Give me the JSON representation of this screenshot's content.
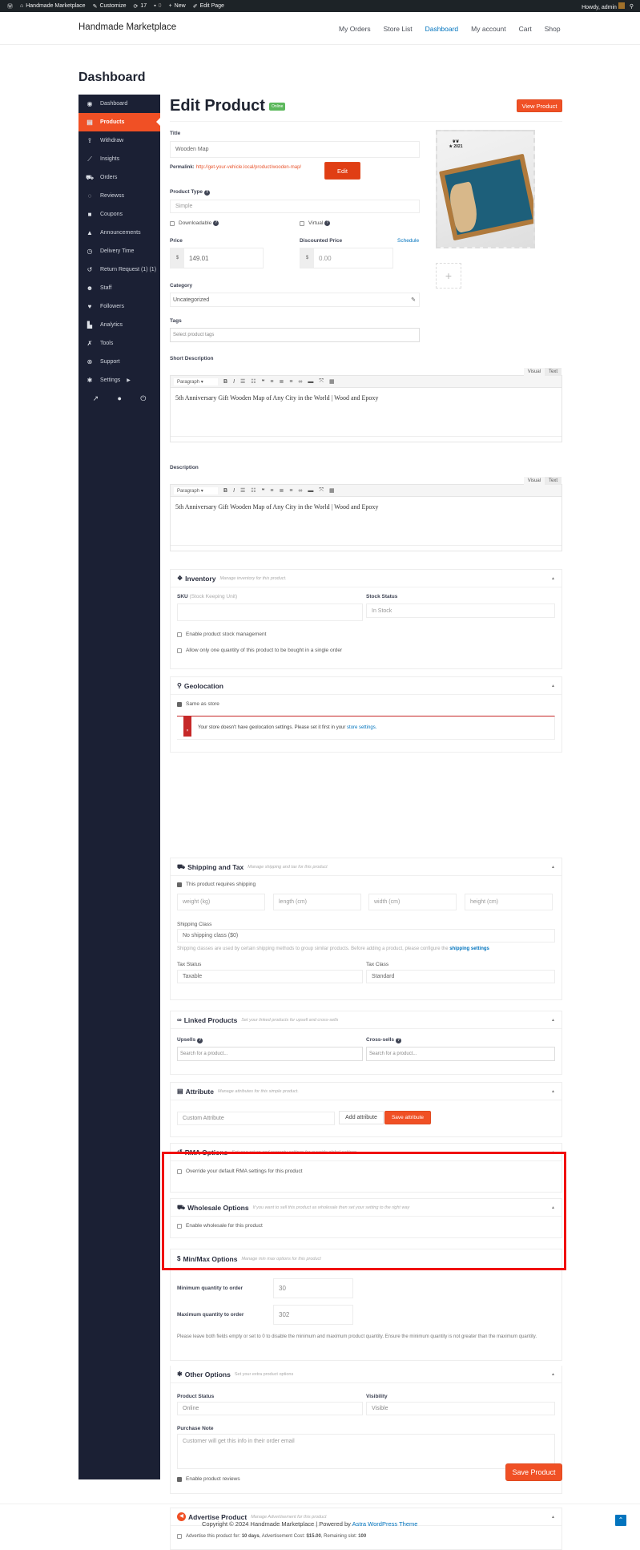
{
  "admin_bar": {
    "wp_icon": "wordpress-logo-icon",
    "site_name": "Handmade Marketplace",
    "customize": "Customize",
    "updates_count": "17",
    "comments_count": "0",
    "new_label": "New",
    "edit_page": "Edit Page",
    "howdy": "Howdy, admin"
  },
  "header": {
    "site_title": "Handmade Marketplace",
    "nav": [
      "My Orders",
      "Store List",
      "Dashboard",
      "My account",
      "Cart",
      "Shop"
    ],
    "active_nav": "Dashboard"
  },
  "page_heading": "Dashboard",
  "sidebar": {
    "items": [
      {
        "label": "Dashboard",
        "icon": "dashboard-icon"
      },
      {
        "label": "Products",
        "icon": "briefcase-icon",
        "active": true
      },
      {
        "label": "Withdraw",
        "icon": "upload-icon"
      },
      {
        "label": "Insights",
        "icon": "line-chart-icon"
      },
      {
        "label": "Orders",
        "icon": "cart-icon"
      },
      {
        "label": "Reviewss",
        "icon": "comments-icon"
      },
      {
        "label": "Coupons",
        "icon": "gift-icon"
      },
      {
        "label": "Announcements",
        "icon": "bell-icon"
      },
      {
        "label": "Delivery Time",
        "icon": "clock-icon"
      },
      {
        "label": "Return Request (1) (1)",
        "icon": "undo-icon"
      },
      {
        "label": "Staff",
        "icon": "users-icon"
      },
      {
        "label": "Followers",
        "icon": "heart-icon"
      },
      {
        "label": "Analytics",
        "icon": "area-chart-icon"
      },
      {
        "label": "Tools",
        "icon": "wrench-icon"
      },
      {
        "label": "Support",
        "icon": "lifebuoy-icon"
      },
      {
        "label": "Settings",
        "icon": "gear-icon"
      }
    ]
  },
  "edit": {
    "title": "Edit Product",
    "status_badge": "Online",
    "view_product": "View Product",
    "title_label": "Title",
    "title_value": "Wooden Map",
    "permalink_label": "Permalink:",
    "permalink_url": "http://get-your-vehicle.local/product/wooden-map/",
    "edit_button": "Edit",
    "product_type_label": "Product Type",
    "product_type_value": "Simple",
    "downloadable": "Downloadable",
    "virtual": "Virtual",
    "price_label": "Price",
    "currency": "$",
    "price_value": "149.01",
    "discounted_label": "Discounted Price",
    "schedule": "Schedule",
    "discounted_placeholder": "0.00",
    "category_label": "Category",
    "category_value": "Uncategorized",
    "tags_label": "Tags",
    "tags_placeholder": "Select product tags",
    "add_image": "+"
  },
  "short_description": {
    "label": "Short Description",
    "tabs": [
      "Visual",
      "Text"
    ],
    "format": "Paragraph",
    "content": "5th Anniversary Gift Wooden Map of Any City in the World | Wood and Epoxy"
  },
  "description": {
    "label": "Description",
    "tabs": [
      "Visual",
      "Text"
    ],
    "format": "Paragraph",
    "content": "5th Anniversary Gift Wooden Map of Any City in the World | Wood and Epoxy"
  },
  "inventory": {
    "title": "Inventory",
    "subtitle": "Manage inventory for this product.",
    "sku_label": "SKU",
    "sku_hint": "(Stock Keeping Unit)",
    "sku_value": "",
    "stock_status_label": "Stock Status",
    "stock_status_value": "In Stock",
    "manage_stock": "Enable product stock management",
    "sold_individually": "Allow only one quantity of this product to be bought in a single order"
  },
  "geolocation": {
    "title": "Geolocation",
    "same_as_store": "Same as store",
    "alert_text": "Your store doesn't have geolocation settings. Please set it first in your",
    "alert_link": "store settings."
  },
  "shipping": {
    "title": "Shipping and Tax",
    "subtitle": "Manage shipping and tax for this product",
    "requires_shipping": "This product requires shipping",
    "weight_placeholder": "weight (kg)",
    "length_placeholder": "length (cm)",
    "width_placeholder": "width (cm)",
    "height_placeholder": "height (cm)",
    "class_label": "Shipping Class",
    "class_value": "No shipping class ($0)",
    "class_help": "Shipping classes are used by certain shipping methods to group similar products. Before adding a product, please configure the",
    "class_help_link": "shipping settings",
    "tax_status_label": "Tax Status",
    "tax_status_value": "Taxable",
    "tax_class_label": "Tax Class",
    "tax_class_value": "Standard"
  },
  "linked": {
    "title": "Linked Products",
    "subtitle": "Set your linked products for upsell and cross-sells",
    "upsells_label": "Upsells",
    "crosssells_label": "Cross-sells",
    "search_placeholder": "Search for a product..."
  },
  "attribute": {
    "title": "Attribute",
    "subtitle": "Manage attributes for this simple product.",
    "select_value": "Custom Attribute",
    "add_button": "Add attribute",
    "save_button": "Save attribute"
  },
  "rma": {
    "title": "RMA Options",
    "subtitle": "Set your return and warranty settings for override global settings",
    "override": "Override your default RMA settings for this product"
  },
  "wholesale": {
    "title": "Wholesale Options",
    "subtitle": "If you want to sell this product as wholesale then set your setting to the right way",
    "enable": "Enable wholesale for this product"
  },
  "minmax": {
    "title": "Min/Max Options",
    "subtitle": "Manage min max options for this product",
    "min_label": "Minimum quantity to order",
    "min_value": "30",
    "max_label": "Maximum quantity to order",
    "max_value": "302",
    "help": "Please leave both fields empty or set to 0 to disable the minimum and maximum product quantity. Ensure the minimum quantity is not greater than the maximum quantity."
  },
  "other": {
    "title": "Other Options",
    "subtitle": "Set your extra product options",
    "status_label": "Product Status",
    "status_value": "Online",
    "visibility_label": "Visibility",
    "visibility_value": "Visible",
    "note_label": "Purchase Note",
    "note_placeholder": "Customer will get this info in their order email",
    "reviews": "Enable product reviews"
  },
  "advertise": {
    "title": "Advertise Product",
    "subtitle": "Manage Advertisement for this product",
    "text_1": "Advertise this product for:",
    "days": "10 days",
    "text_2": ", Advertisement Cost:",
    "cost": "$15.00",
    "text_3": ", Remaining slot:",
    "slots": "100"
  },
  "save_product": "Save Product",
  "footer": {
    "copyright": "Copyright © 2024 Handmade Marketplace | Powered by",
    "theme_link": "Astra WordPress Theme"
  },
  "colors": {
    "accent": "#f05025",
    "sidebar": "#1b2034",
    "link": "#0274be",
    "highlight": "#f01010"
  }
}
